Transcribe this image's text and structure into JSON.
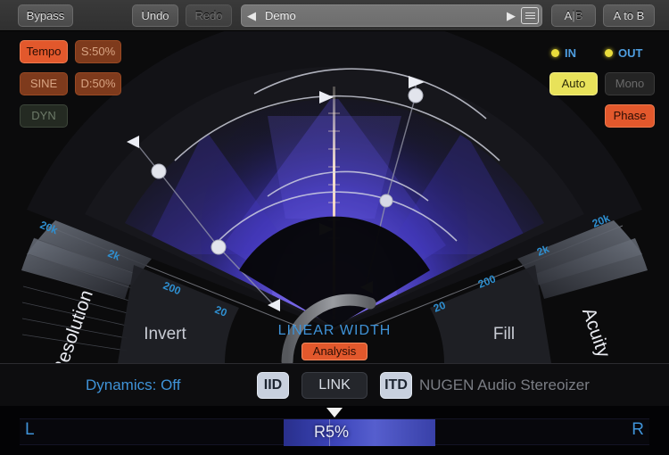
{
  "toolbar": {
    "bypass_label": "Bypass",
    "undo_label": "Undo",
    "redo_label": "Redo",
    "preset_name": "Demo",
    "preset_prev_icon": "left-triangle-icon",
    "preset_next_icon": "right-triangle-icon",
    "preset_menu_icon": "list-menu-icon",
    "ab_a_label": "A",
    "ab_sep_label": "|",
    "ab_b_label": "B",
    "a_to_b_label": "A to B"
  },
  "left_controls": {
    "tempo_label": "Tempo",
    "s_label": "S:50%",
    "sine_label": "SINE",
    "d_label": "D:50%",
    "dyn_label": "DYN"
  },
  "right_controls": {
    "in_label": "IN",
    "out_label": "OUT",
    "in_led_icon": "led-indicator-icon",
    "out_led_icon": "led-indicator-icon",
    "auto_label": "Auto",
    "mono_label": "Mono",
    "phase_label": "Phase"
  },
  "display": {
    "center_label": "LINEAR WIDTH",
    "analysis_label": "Analysis",
    "left_panel_label": "Resolution",
    "left_inner_label": "Invert",
    "right_inner_label": "Fill",
    "right_panel_label": "Acuity",
    "freq_ticks": [
      "20k",
      "2k",
      "200",
      "20"
    ]
  },
  "statusbar": {
    "dynamics_label": "Dynamics: Off",
    "iid_label": "IID",
    "link_label": "LINK",
    "itd_label": "ITD",
    "brand_label": "NUGEN Audio Stereoizer"
  },
  "meter": {
    "left_label": "L",
    "right_label": "R",
    "value_label": "R5%"
  },
  "colors": {
    "accent_orange": "#e2582c",
    "accent_yellow": "#e8e25a",
    "accent_blue": "#3f93d8",
    "tick_blue": "#2e8fd0",
    "panel_bg": "#0b0b0c",
    "energy_blue": "#4a3fd0"
  }
}
